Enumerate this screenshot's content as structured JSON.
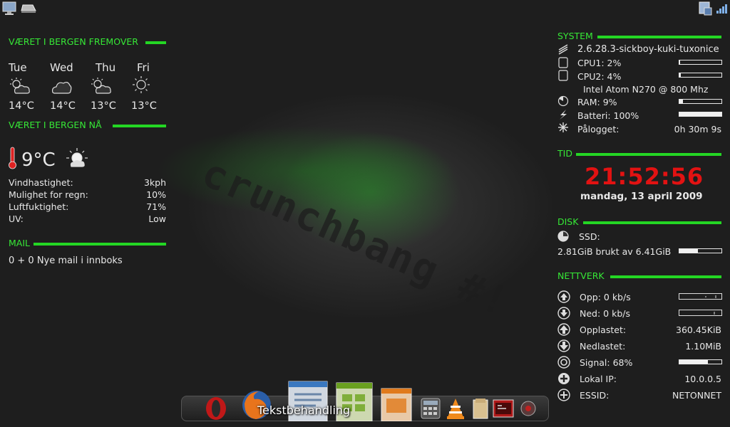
{
  "weather_forecast": {
    "header": "VÆRET I BERGEN FREMOVER",
    "days": [
      {
        "day": "Tue",
        "temp": "14°C",
        "icon": "partly-cloudy-icon"
      },
      {
        "day": "Wed",
        "temp": "14°C",
        "icon": "cloudy-icon"
      },
      {
        "day": "Thu",
        "temp": "13°C",
        "icon": "partly-cloudy-icon"
      },
      {
        "day": "Fri",
        "temp": "13°C",
        "icon": "sunny-icon"
      }
    ]
  },
  "weather_now": {
    "header": "VÆRET I BERGEN NÅ",
    "temp": "9°C",
    "rows": [
      {
        "label": "Vindhastighet:",
        "value": "3kph"
      },
      {
        "label": "Mulighet for regn:",
        "value": "10%"
      },
      {
        "label": "Luftfuktighet:",
        "value": "71%"
      },
      {
        "label": "UV:",
        "value": "Low"
      }
    ]
  },
  "mail": {
    "header": "MAIL",
    "text": "0 + 0 Nye mail i innboks"
  },
  "system": {
    "header": "SYSTEM",
    "kernel": "2.6.28.3-sickboy-kuki-tuxonice",
    "cpu1": "CPU1: 2%",
    "cpu1_fraction": 0.02,
    "cpu2": "CPU2: 4%",
    "cpu2_fraction": 0.04,
    "cpu_model": "Intel Atom N270 @ 800 Mhz",
    "ram": "RAM: 9%",
    "ram_fraction": 0.09,
    "battery": "Batteri: 100%",
    "battery_fraction": 1.0,
    "uptime_label": "Pålogget:",
    "uptime_value": "0h 30m 9s"
  },
  "time": {
    "header": "TID",
    "clock": "21:52:56",
    "date": "mandag, 13 april 2009"
  },
  "disk": {
    "header": "DISK",
    "ssd_label": "SSD:",
    "usage": "2.81GiB brukt av 6.41GiB",
    "usage_fraction": 0.44
  },
  "network": {
    "header": "NETTVERK",
    "up": "Opp: 0 kb/s",
    "down": "Ned: 0 kb/s",
    "uploaded_label": "Opplastet:",
    "uploaded_value": "360.45KiB",
    "downloaded_label": "Nedlastet:",
    "downloaded_value": "1.10MiB",
    "signal": "Signal: 68%",
    "signal_fraction": 0.68,
    "ip_label": "Lokal IP:",
    "ip_value": "10.0.0.5",
    "essid_label": "ESSID:",
    "essid_value": "NETONNET"
  },
  "wallpaper_text": "crunchbang #!",
  "dock": {
    "tooltip": "Tekstbehandling",
    "items": [
      "opera-icon",
      "firefox-icon",
      "writer-icon",
      "calc-icon",
      "impress-icon",
      "calculator-icon",
      "vlc-icon",
      "file-manager-icon",
      "terminal-icon",
      "settings-icon"
    ]
  },
  "colors": {
    "accent": "#24d624",
    "clock": "#e21212"
  }
}
